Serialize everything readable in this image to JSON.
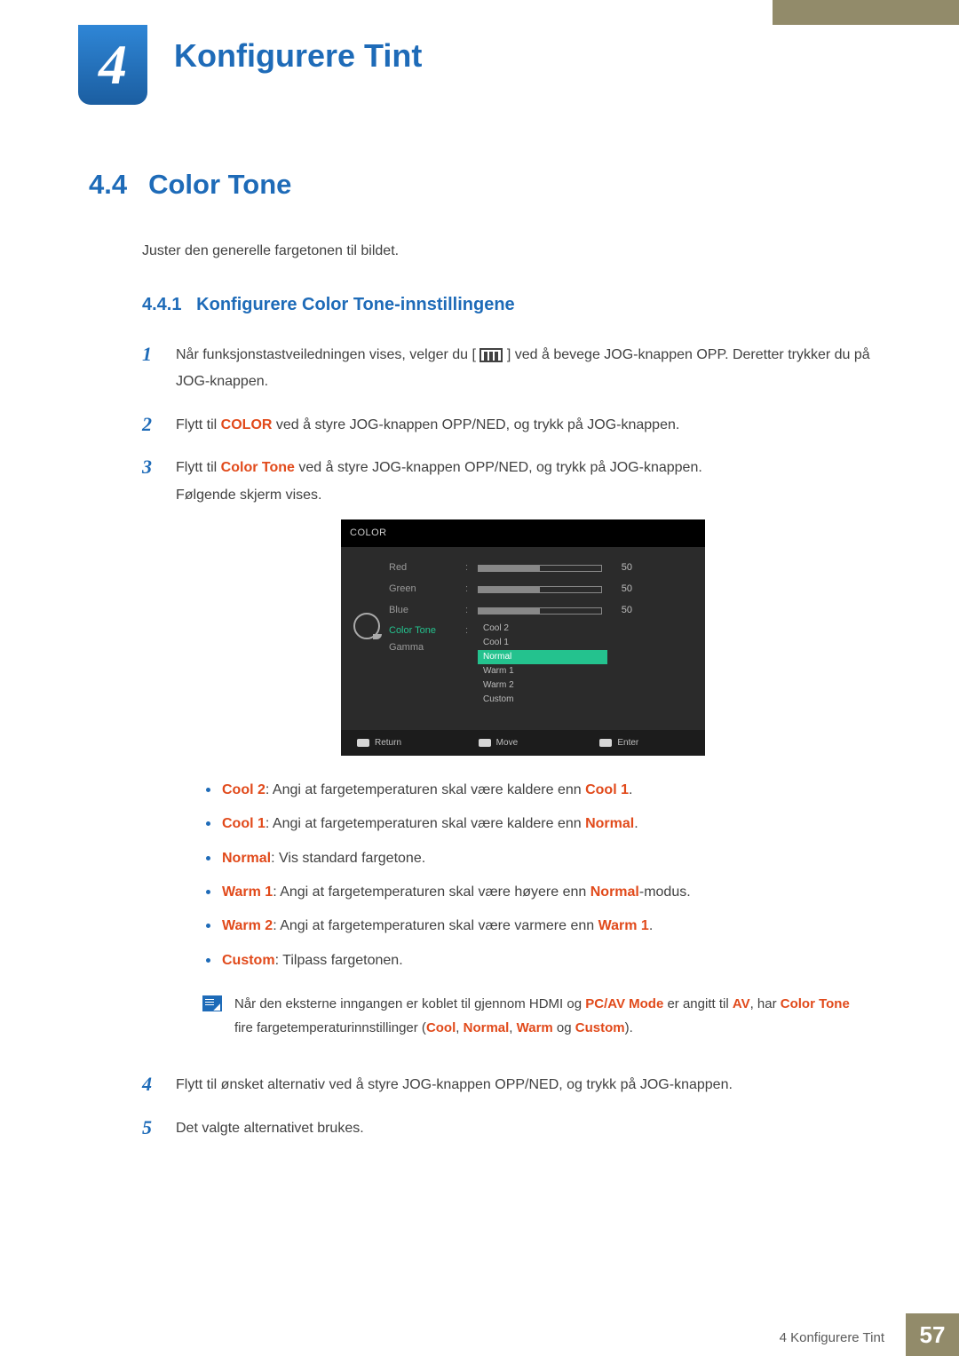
{
  "chapter": {
    "num": "4",
    "title": "Konfigurere Tint"
  },
  "section": {
    "num": "4.4",
    "title": "Color Tone",
    "intro": "Juster den generelle fargetonen til bildet."
  },
  "subsection": {
    "num": "4.4.1",
    "title": "Konfigurere Color Tone-innstillingene"
  },
  "steps": {
    "s1": {
      "num": "1",
      "a": "Når funksjonstastveiledningen vises, velger du [",
      "b": "] ved å bevege JOG-knappen OPP. Deretter trykker du på JOG-knappen."
    },
    "s2": {
      "num": "2",
      "pre": "Flytt til ",
      "hl": "COLOR",
      "post": " ved å styre JOG-knappen OPP/NED, og trykk på JOG-knappen."
    },
    "s3": {
      "num": "3",
      "pre": "Flytt til ",
      "hl": "Color Tone",
      "post": " ved å styre JOG-knappen OPP/NED, og trykk på JOG-knappen.",
      "tail": "Følgende skjerm vises."
    },
    "s4": {
      "num": "4",
      "text": "Flytt til ønsket alternativ ved å styre JOG-knappen OPP/NED, og trykk på JOG-knappen."
    },
    "s5": {
      "num": "5",
      "text": "Det valgte alternativet brukes."
    }
  },
  "osd": {
    "title": "COLOR",
    "rows": {
      "red": {
        "label": "Red",
        "value": "50"
      },
      "green": {
        "label": "Green",
        "value": "50"
      },
      "blue": {
        "label": "Blue",
        "value": "50"
      },
      "ct": {
        "label": "Color Tone"
      },
      "gamma": {
        "label": "Gamma"
      }
    },
    "options": {
      "cool2": "Cool 2",
      "cool1": "Cool 1",
      "normal": "Normal",
      "warm1": "Warm 1",
      "warm2": "Warm 2",
      "custom": "Custom"
    },
    "footer": {
      "return": "Return",
      "move": "Move",
      "enter": "Enter"
    }
  },
  "defs": {
    "cool2": {
      "hl": "Cool 2",
      "a": ": Angi at fargetemperaturen skal være kaldere enn ",
      "ref": "Cool 1",
      "b": "."
    },
    "cool1": {
      "hl": "Cool 1",
      "a": ": Angi at fargetemperaturen skal være kaldere enn ",
      "ref": "Normal",
      "b": "."
    },
    "normal": {
      "hl": "Normal",
      "a": ": Vis standard fargetone."
    },
    "warm1": {
      "hl": "Warm 1",
      "a": ": Angi at fargetemperaturen skal være høyere enn ",
      "ref": "Normal",
      "b": "-modus."
    },
    "warm2": {
      "hl": "Warm 2",
      "a": ": Angi at fargetemperaturen skal være varmere enn ",
      "ref": "Warm 1",
      "b": "."
    },
    "custom": {
      "hl": "Custom",
      "a": ": Tilpass fargetonen."
    }
  },
  "note": {
    "a": "Når den eksterne inngangen er koblet til gjennom HDMI og ",
    "hl1": "PC/AV Mode",
    "b": " er angitt til ",
    "hl2": "AV",
    "c": ", har ",
    "hl3": "Color Tone",
    "d": " fire fargetemperaturinnstillinger (",
    "o1": "Cool",
    "sep1": ", ",
    "o2": "Normal",
    "sep2": ", ",
    "o3": "Warm",
    "sep3": " og ",
    "o4": "Custom",
    "e": ")."
  },
  "footer": {
    "text": "4 Konfigurere Tint",
    "page": "57"
  }
}
